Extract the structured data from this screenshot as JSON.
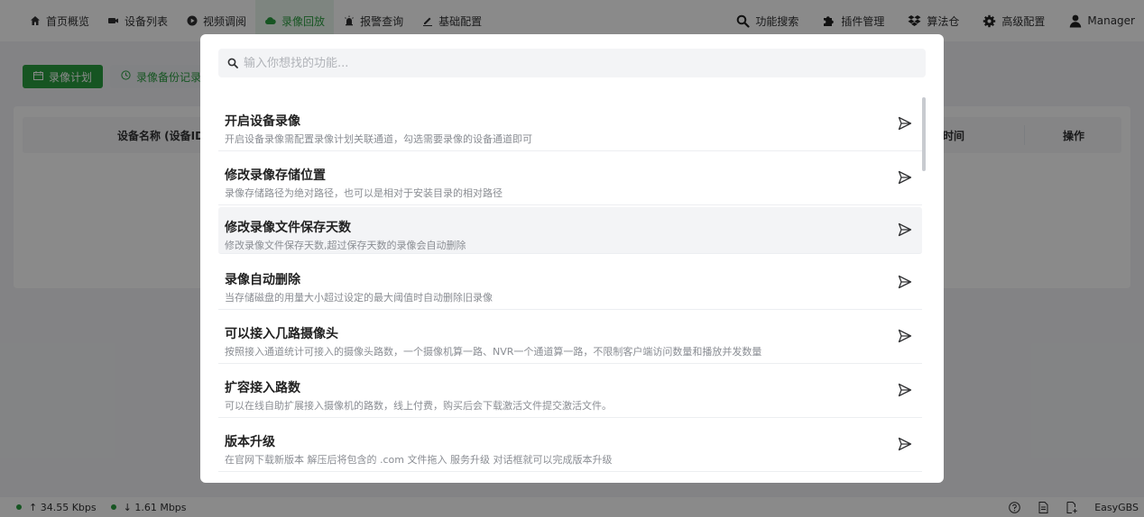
{
  "nav": {
    "items": [
      {
        "label": "首页概览",
        "icon": "home-icon"
      },
      {
        "label": "设备列表",
        "icon": "camera-icon"
      },
      {
        "label": "视频调阅",
        "icon": "play-icon"
      },
      {
        "label": "录像回放",
        "icon": "cloud-icon",
        "active": true
      },
      {
        "label": "报警查询",
        "icon": "alarm-icon"
      },
      {
        "label": "基础配置",
        "icon": "edit-icon"
      }
    ],
    "right": [
      {
        "label": "功能搜索",
        "icon": "search-icon"
      },
      {
        "label": "插件管理",
        "icon": "puzzle-icon"
      },
      {
        "label": "算法仓",
        "icon": "dropbox-icon"
      },
      {
        "label": "高级配置",
        "icon": "gear-icon"
      },
      {
        "label": "Manager",
        "icon": "user-icon"
      }
    ]
  },
  "page": {
    "tab_plan": "录像计划",
    "tab_backup": "录像备份记录",
    "columns": {
      "device_name": "设备名称 (设备ID)",
      "time": "时间",
      "action": "操作"
    }
  },
  "status": {
    "upload": "↑ 34.55 Kbps",
    "download": "↓ 1.61 Mbps",
    "brand": "EasyGBS"
  },
  "modal": {
    "search_placeholder": "输入你想找的功能...",
    "items": [
      {
        "title": "开启设备录像",
        "desc": "开启设备录像需配置录像计划关联通道，勾选需要录像的设备通道即可"
      },
      {
        "title": "修改录像存储位置",
        "desc": "录像存储路径为绝对路径，也可以是相对于安装目录的相对路径"
      },
      {
        "title": "修改录像文件保存天数",
        "desc": "修改录像文件保存天数,超过保存天数的录像会自动删除"
      },
      {
        "title": "录像自动删除",
        "desc": "当存储磁盘的用量大小超过设定的最大阈值时自动删除旧录像"
      },
      {
        "title": "可以接入几路摄像头",
        "desc": "按照接入通道统计可接入的摄像头路数，一个摄像机算一路、NVR一个通道算一路，不限制客户端访问数量和播放并发数量"
      },
      {
        "title": "扩容接入路数",
        "desc": "可以在线自助扩展接入摄像机的路数，线上付费，购买后会下载激活文件提交激活文件。"
      },
      {
        "title": "版本升级",
        "desc": "在官网下载新版本 解压后将包含的 .com 文件拖入 服务升级 对话框就可以完成版本升级"
      }
    ]
  },
  "colors": {
    "accent": "#2a9d3f",
    "overlay": "rgba(0,0,0,0.46)"
  }
}
